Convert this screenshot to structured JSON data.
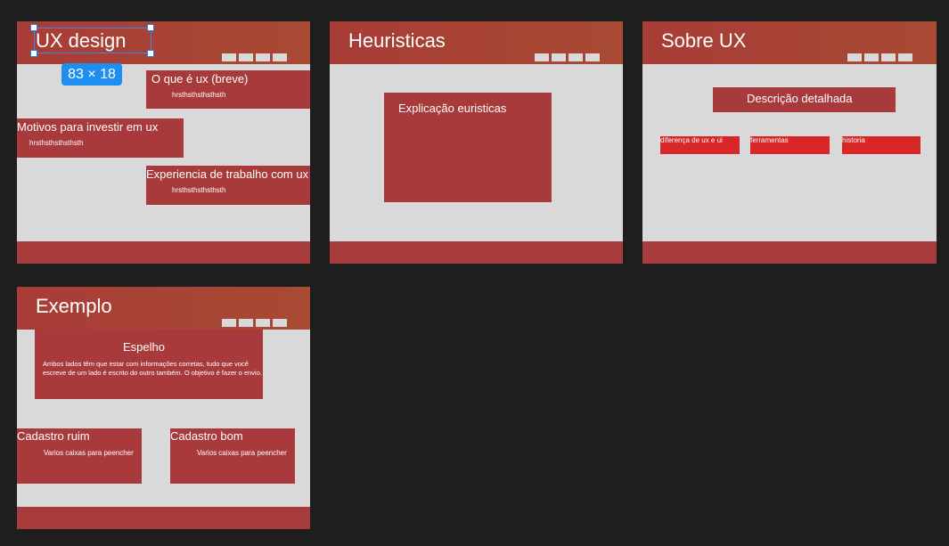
{
  "frames": {
    "ux_design": {
      "title": "UX design",
      "card1": {
        "heading": "O que é ux (breve)",
        "text": "hrsthsthsthsthsth"
      },
      "card2": {
        "heading": "Motivos para investir em ux",
        "text": "hrsthsthsthsthsth"
      },
      "card3": {
        "heading": "Experiencia de trabalho com ux",
        "text": "hrsthsthsthsthsth"
      }
    },
    "heuristicas": {
      "title": "Heuristicas",
      "card": {
        "heading": "Explicação euristicas"
      }
    },
    "sobre_ux": {
      "title": "Sobre UX",
      "card": {
        "heading": "Descrição detalhada"
      },
      "tabs": [
        "diferença de ux e ui",
        "ferramentas",
        "historia"
      ]
    },
    "exemplo": {
      "title": "Exemplo",
      "mirror": {
        "heading": "Espelho",
        "text": "Ambos lados têm que estar com informações corretas, tudo que você escreve de um lado é escrito do outro também. O objetivo é fazer o envio."
      },
      "bad": {
        "heading": "Cadastro ruim",
        "text": "Varios caixas para peencher"
      },
      "good": {
        "heading": "Cadastro bom",
        "text": "Varios caixas para peencher"
      }
    }
  },
  "selection": {
    "dimension_label": "83 × 18"
  },
  "colors": {
    "canvas": "#1e1e1e",
    "frame": "#d9d9d9",
    "header": "#a83c36",
    "card": "#a83a3c",
    "tab": "#d92626",
    "selection": "#1e8ff0"
  }
}
